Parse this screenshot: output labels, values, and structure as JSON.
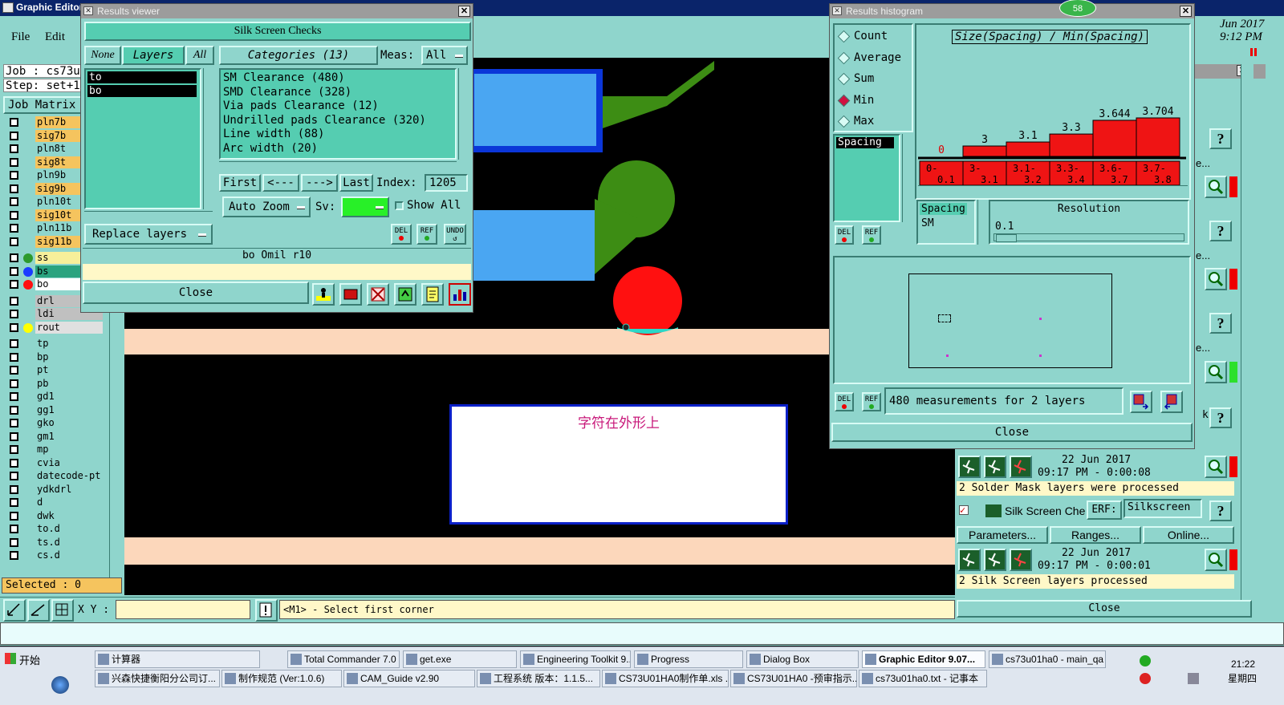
{
  "main_window": {
    "title": "Graphic Editor",
    "menu": [
      "File",
      "Edit"
    ],
    "job_label": "Job : cs73u",
    "step_label": "Step: set+1",
    "job_matrix": "Job Matrix",
    "selected": "Selected : 0",
    "xy_label": "X Y :",
    "xy_value": "",
    "status_prompt": "<M1> - Select first corner"
  },
  "layers": [
    {
      "name": "pln7b",
      "color": "#f5c45e",
      "dot": ""
    },
    {
      "name": "sig7b",
      "color": "#f5c45e",
      "dot": ""
    },
    {
      "name": "pln8t",
      "color": "#8fd5cc",
      "dot": ""
    },
    {
      "name": "sig8t",
      "color": "#f5c45e",
      "dot": ""
    },
    {
      "name": "pln9b",
      "color": "#8fd5cc",
      "dot": ""
    },
    {
      "name": "sig9b",
      "color": "#f5c45e",
      "dot": ""
    },
    {
      "name": "pln10t",
      "color": "#8fd5cc",
      "dot": ""
    },
    {
      "name": "sig10t",
      "color": "#f5c45e",
      "dot": ""
    },
    {
      "name": "pln11b",
      "color": "#8fd5cc",
      "dot": ""
    },
    {
      "name": "sig11b",
      "color": "#f5c45e",
      "dot": ""
    },
    {
      "name": "ss",
      "color": "#f7ef9a",
      "dot": "#2d9a2d"
    },
    {
      "name": "bs",
      "color": "#2aa37f",
      "dot": "#1a3cff"
    },
    {
      "name": "bo",
      "color": "#ffffff",
      "dot": "#ff1010"
    },
    {
      "name": "drl",
      "color": "#c0c0c0",
      "dot": ""
    },
    {
      "name": "ldi",
      "color": "#c0c0c0",
      "dot": ""
    },
    {
      "name": "rout",
      "color": "#e0e0e0",
      "dot": "#ffff00"
    },
    {
      "name": "tp",
      "color": "#8fd5cc",
      "dot": ""
    },
    {
      "name": "bp",
      "color": "#8fd5cc",
      "dot": ""
    },
    {
      "name": "pt",
      "color": "#8fd5cc",
      "dot": ""
    },
    {
      "name": "pb",
      "color": "#8fd5cc",
      "dot": ""
    },
    {
      "name": "gd1",
      "color": "#8fd5cc",
      "dot": ""
    },
    {
      "name": "gg1",
      "color": "#8fd5cc",
      "dot": ""
    },
    {
      "name": "gko",
      "color": "#8fd5cc",
      "dot": ""
    },
    {
      "name": "gm1",
      "color": "#8fd5cc",
      "dot": ""
    },
    {
      "name": "mp",
      "color": "#8fd5cc",
      "dot": ""
    },
    {
      "name": "cvia",
      "color": "#8fd5cc",
      "dot": ""
    },
    {
      "name": "datecode-pt",
      "color": "#8fd5cc",
      "dot": ""
    },
    {
      "name": "ydkdrl",
      "color": "#8fd5cc",
      "dot": ""
    },
    {
      "name": "d",
      "color": "#8fd5cc",
      "dot": ""
    },
    {
      "name": "dwk",
      "color": "#8fd5cc",
      "dot": ""
    },
    {
      "name": "to.d",
      "color": "#8fd5cc",
      "dot": ""
    },
    {
      "name": "ts.d",
      "color": "#8fd5cc",
      "dot": ""
    },
    {
      "name": "cs.d",
      "color": "#8fd5cc",
      "dot": ""
    }
  ],
  "canvas": {
    "annotation": "字符在外形上"
  },
  "results_viewer": {
    "title": "Results viewer",
    "header": "Silk Screen Checks",
    "tab_none": "None",
    "tab_layers": "Layers",
    "tab_all": "All",
    "layer_items": [
      "to",
      "bo"
    ],
    "categories_label": "Categories (13)",
    "meas_label": "Meas:",
    "meas_value": "All",
    "categories": [
      "SM Clearance (480)",
      "SMD Clearance (328)",
      "Via pads Clearance (12)",
      "Undrilled pads Clearance (320)",
      "Line width (88)",
      "Arc width (20)"
    ],
    "nav_first": "First",
    "nav_prev": "<---",
    "nav_next": "--->",
    "nav_last": "Last",
    "index_label": "Index:",
    "index_value": "1205",
    "auto_zoom": "Auto Zoom",
    "sv_label": "Sv:",
    "show_all": "Show All",
    "replace_layers": "Replace layers",
    "del": "DEL",
    "ref": "REF",
    "undo": "UNDO",
    "status": "bo  Omil   r10",
    "close": "Close"
  },
  "histogram": {
    "title": "Results histogram",
    "badge": "58",
    "options": [
      "Count",
      "Average",
      "Sum",
      "Min",
      "Max"
    ],
    "selected_option": "Min",
    "list_item": "Spacing",
    "plot_title": "Size(Spacing) / Min(Spacing)",
    "spacing_label": "Spacing",
    "spacing_sub": "SM",
    "resolution_label": "Resolution",
    "resolution_value": "0.1",
    "del": "DEL",
    "ref": "REF",
    "measurements": "480 measurements for 2 layers",
    "close": "Close",
    "chart_data": {
      "type": "bar",
      "title": "Size(Spacing) / Min(Spacing)",
      "categories": [
        "0-0.1",
        "3-3.1",
        "3.1-3.2",
        "3.3-3.4",
        "3.6-3.7",
        "3.7-3.8"
      ],
      "values": [
        0,
        3,
        3.1,
        3.3,
        3.644,
        3.704
      ],
      "ylim": [
        0,
        3.704
      ]
    }
  },
  "right_panel": {
    "clock_date": "Jun 2017",
    "clock_time": "9:12 PM",
    "sm_date": "22 Jun 2017",
    "sm_time": "09:17 PM - 0:00:08",
    "sm_msg": "2 Solder Mask layers were processed",
    "silk_name": "Silk Screen Che",
    "erf_label": "ERF:",
    "erf_value": "Silkscreen",
    "parameters": "Parameters...",
    "ranges": "Ranges...",
    "online": "Online...",
    "silk_date": "22 Jun 2017",
    "silk_time": "09:17 PM - 0:00:01",
    "silk_msg": "2 Silk Screen layers processed",
    "close": "Close",
    "help": "?",
    "frag_e": "e...",
    "frag_k": "k"
  },
  "taskbar": {
    "start": "开始",
    "row1": [
      "计算器",
      "Total Commander 7.0 ...",
      "get.exe",
      "Engineering Toolkit 9....",
      "Progress",
      "Dialog Box",
      "Graphic Editor 9.07...",
      "cs73u01ha0 - main_qa"
    ],
    "row2": [
      "兴森快捷衡阳分公司订...",
      "制作规范 (Ver:1.0.6)",
      "CAM_Guide v2.90",
      "工程系统  版本：1.1.5...",
      "CS73U01HA0制作单.xls ...",
      "CS73U01HA0 -预审指示...",
      "cs73u01ha0.txt - 记事本"
    ],
    "time": "21:22",
    "day": "星期四"
  }
}
